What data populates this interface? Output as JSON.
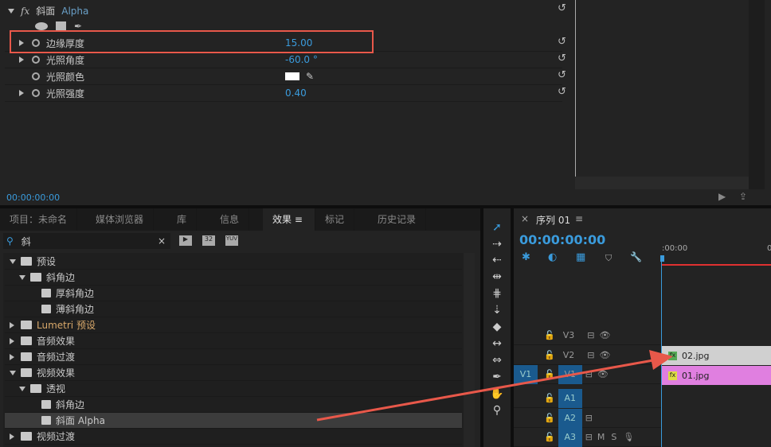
{
  "effect_controls": {
    "effect_name": "斜面",
    "effect_suffix": "Alpha",
    "params": [
      {
        "label": "边缘厚度",
        "value": "15.00",
        "expandable": true
      },
      {
        "label": "光照角度",
        "value": "-60.0 °",
        "expandable": true
      },
      {
        "label": "光照颜色",
        "value": "",
        "expandable": false,
        "color": "#ffffff"
      },
      {
        "label": "光照强度",
        "value": "0.40",
        "expandable": true
      }
    ],
    "timecode": "00:00:00:00"
  },
  "tabs": [
    "项目：未命名",
    "媒体浏览器",
    "库",
    "信息",
    "效果",
    "标记",
    "历史记录"
  ],
  "active_tab": "效果",
  "search": {
    "value": "斜",
    "clear": "×",
    "badges": [
      "32",
      "YUV"
    ]
  },
  "tree": [
    {
      "label": "预设",
      "level": 0,
      "type": "preset-folder",
      "open": true
    },
    {
      "label": "斜角边",
      "level": 1,
      "type": "preset-folder",
      "open": true
    },
    {
      "label": "厚斜角边",
      "level": 2,
      "type": "preset"
    },
    {
      "label": "薄斜角边",
      "level": 2,
      "type": "preset"
    },
    {
      "label": "Lumetri 预设",
      "level": 0,
      "type": "preset-folder",
      "open": false
    },
    {
      "label": "音频效果",
      "level": 0,
      "type": "folder",
      "open": false
    },
    {
      "label": "音频过渡",
      "level": 0,
      "type": "folder",
      "open": false
    },
    {
      "label": "视频效果",
      "level": 0,
      "type": "folder",
      "open": true
    },
    {
      "label": "透视",
      "level": 1,
      "type": "folder",
      "open": true
    },
    {
      "label": "斜角边",
      "level": 2,
      "type": "effect"
    },
    {
      "label": "斜面 Alpha",
      "level": 2,
      "type": "effect",
      "selected": true
    },
    {
      "label": "视频过渡",
      "level": 0,
      "type": "folder",
      "open": false
    }
  ],
  "timeline": {
    "close": "×",
    "title": "序列 01",
    "timecode": "00:00:00:00",
    "ruler": [
      ":00:00",
      "0"
    ],
    "tracks": [
      {
        "name": "V3"
      },
      {
        "name": "V2"
      },
      {
        "name": "V1",
        "source": "V1"
      },
      {
        "name": "A1"
      },
      {
        "name": "A2"
      },
      {
        "name": "A3",
        "m": "M",
        "s": "S"
      }
    ],
    "clips": [
      {
        "name": "02.jpg",
        "track": "V2",
        "color": "#d0d0d0"
      },
      {
        "name": "01.jpg",
        "track": "V1",
        "color": "#e07fe0"
      }
    ]
  },
  "colors": {
    "accent": "#3a9bdc",
    "highlight": "#e8584a"
  }
}
